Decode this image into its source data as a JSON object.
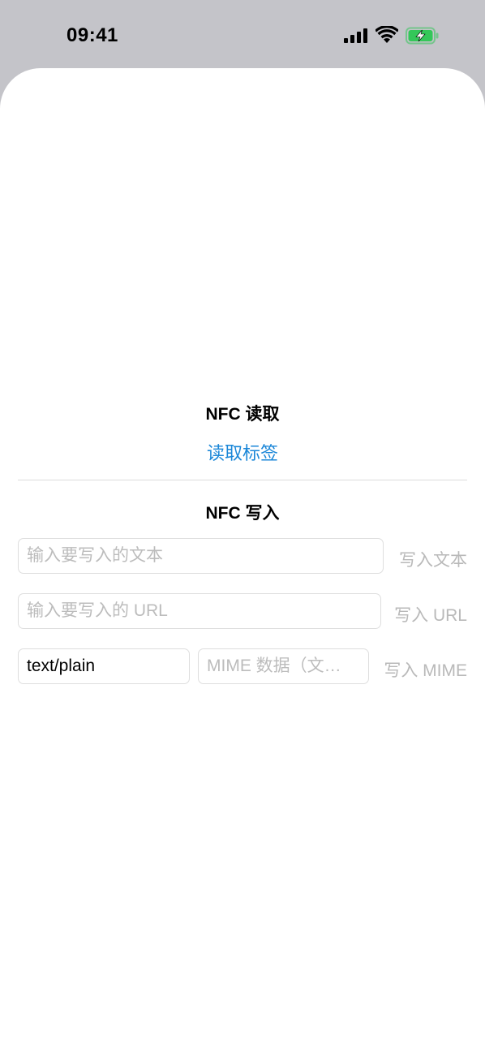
{
  "status_bar": {
    "time": "09:41"
  },
  "nfc_read": {
    "title": "NFC 读取",
    "read_button_label": "读取标签"
  },
  "nfc_write": {
    "title": "NFC 写入",
    "text_input": {
      "placeholder": "输入要写入的文本",
      "value": ""
    },
    "write_text_label": "写入文本",
    "url_input": {
      "placeholder": "输入要写入的 URL",
      "value": ""
    },
    "write_url_label": "写入 URL",
    "mime_type_input": {
      "value": "text/plain"
    },
    "mime_data_input": {
      "placeholder": "MIME 数据（文…",
      "value": ""
    },
    "write_mime_label": "写入 MIME"
  },
  "colors": {
    "accent": "#1b87d8",
    "battery_fill": "#34c759",
    "disabled_text": "#b9b9b9"
  },
  "icons": [
    "signal-icon",
    "wifi-icon",
    "battery-charging-icon"
  ]
}
